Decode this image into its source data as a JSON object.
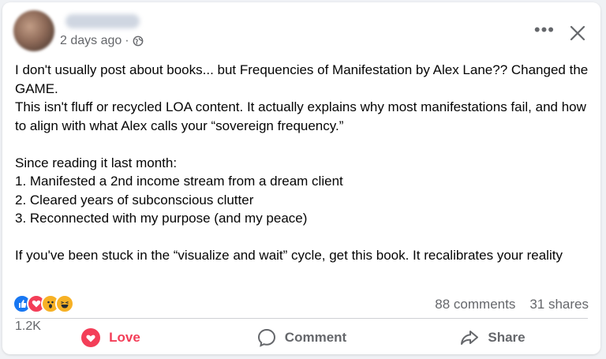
{
  "post": {
    "timestamp": "2 days ago",
    "separator": "·",
    "text": "I don't usually post about books... but Frequencies of Manifestation by Alex Lane?? Changed the GAME.\nThis isn't fluff or recycled LOA content. It actually explains why most manifestations fail, and how to align with what Alex calls your “sovereign frequency.”\n\nSince reading it last month:\n1. Manifested a 2nd income stream from a dream client\n2. Cleared years of subconscious clutter\n3. Reconnected with my purpose (and my peace)\n\nIf you've been stuck in the “visualize and wait” cycle, get this book. It recalibrates your reality"
  },
  "reactions": {
    "icons": [
      "like-icon",
      "love-icon",
      "wow-icon",
      "haha-icon"
    ],
    "count": "1.2K"
  },
  "stats": {
    "comments": "88 comments",
    "shares": "31 shares"
  },
  "actions": {
    "love": "Love",
    "comment": "Comment",
    "share": "Share"
  },
  "colors": {
    "love": "#f33e58",
    "like": "#1877f2",
    "muted": "#65676b"
  }
}
